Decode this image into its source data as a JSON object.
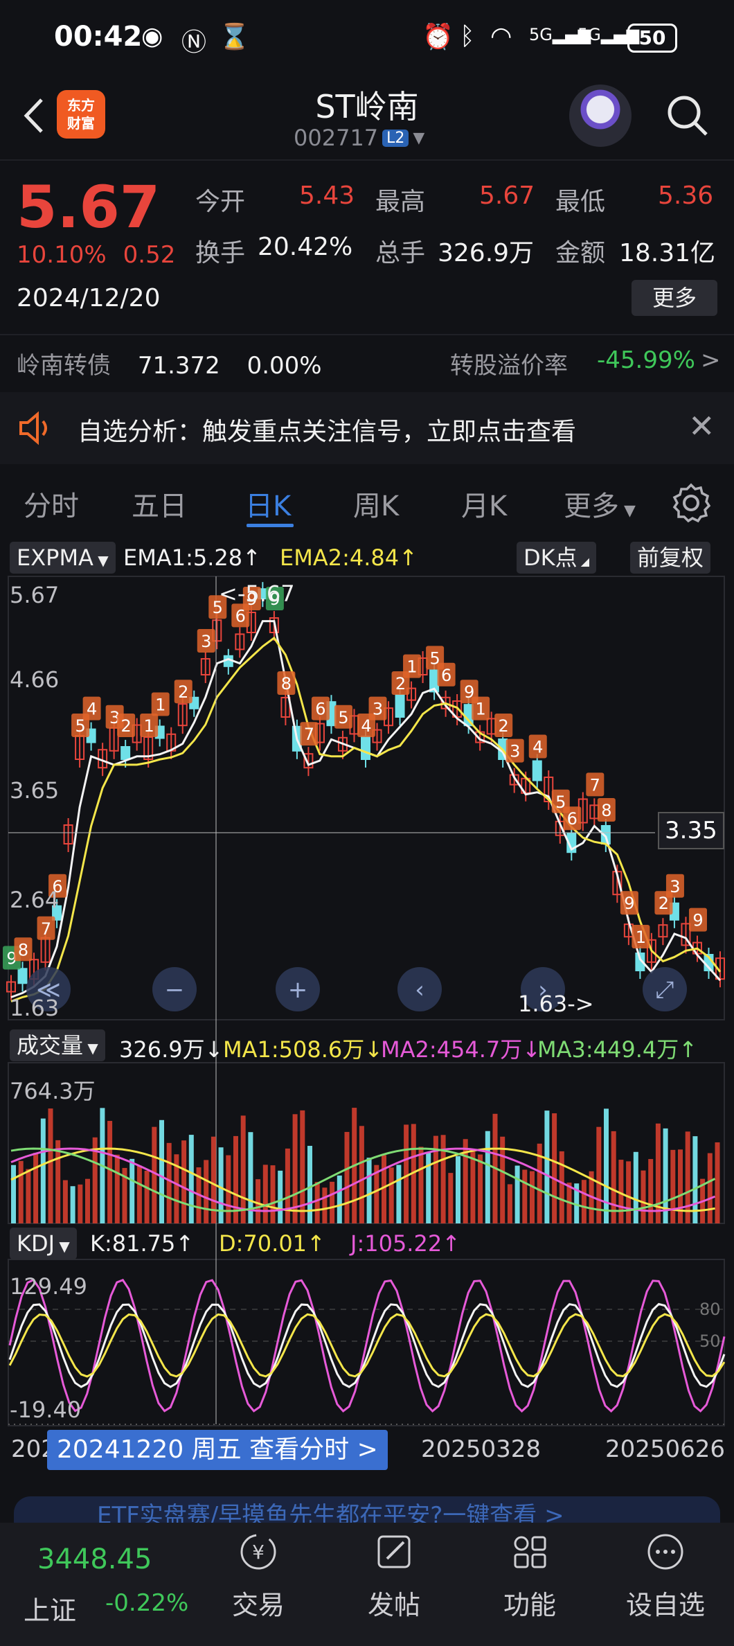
{
  "status_bar": {
    "time": "00:42",
    "battery": "50",
    "network": "5G"
  },
  "header": {
    "stock_name": "ST岭南",
    "stock_code": "002717",
    "level_badge": "L2",
    "brand_line1": "东方",
    "brand_line2": "财富"
  },
  "quote": {
    "price": "5.67",
    "change_pct": "10.10%",
    "change_amt": "0.52",
    "date": "2024/12/20",
    "open_label": "今开",
    "open": "5.43",
    "high_label": "最高",
    "high": "5.67",
    "low_label": "最低",
    "low": "5.36",
    "turnover_label": "换手",
    "turnover": "20.42%",
    "volume_label": "总手",
    "volume": "326.9万",
    "amount_label": "金额",
    "amount": "18.31亿",
    "more_label": "更多"
  },
  "convertible": {
    "name": "岭南转债",
    "price": "71.372",
    "change": "0.00%",
    "premium_label": "转股溢价率",
    "premium": "-45.99%",
    "arrow": ">"
  },
  "notice": {
    "text": "自选分析：触发重点关注信号，立即点击查看",
    "close": "✕"
  },
  "tabs": [
    {
      "label": "分时"
    },
    {
      "label": "五日"
    },
    {
      "label": "日K"
    },
    {
      "label": "周K"
    },
    {
      "label": "月K"
    },
    {
      "label": "更多"
    }
  ],
  "main_chart": {
    "indicator": "EXPMA",
    "ema1": "EMA1:5.28↑",
    "ema2": "EMA2:4.84↑",
    "dk_label": "DK点",
    "adjust_label": "前复权",
    "axis": [
      "5.67",
      "4.66",
      "3.65",
      "2.64",
      "1.63"
    ],
    "cursor_price": "3.35",
    "high_marker": "<-5.67",
    "low_marker": "1.63->",
    "td_marks": [
      "9",
      "8",
      "7",
      "6",
      "5",
      "4",
      "3",
      "2",
      "1",
      "1",
      "2",
      "3",
      "5",
      "6",
      "9",
      "9",
      "8",
      "7",
      "6",
      "5",
      "4",
      "3",
      "2",
      "1",
      "5",
      "6",
      "9",
      "1",
      "2",
      "3",
      "4",
      "5",
      "6",
      "7",
      "8",
      "9",
      "1",
      "2",
      "3",
      "9"
    ]
  },
  "volume_chart": {
    "indicator": "成交量",
    "current": "326.9万↓",
    "ma1": "MA1:508.6万↓",
    "ma2": "MA2:454.7万↓",
    "ma3": "MA3:449.4万↑",
    "axis_top": "764.3万"
  },
  "kdj_chart": {
    "indicator": "KDJ",
    "k": "K:81.75↑",
    "d": "D:70.01↑",
    "j": "J:105.22↑",
    "axis_top": "129.49",
    "axis_bottom": "-19.40",
    "level_80": "80",
    "level_50": "50"
  },
  "date_axis": {
    "start": "202",
    "mid": "20250328",
    "end": "20250626",
    "banner": "20241220 周五 查看分时 >"
  },
  "ad": {
    "text": "ETF实盘赛/早摸鱼先生都在平安?一键查看 >"
  },
  "bottom_nav": {
    "index_value": "3448.45",
    "index_name": "上证",
    "index_change": "-0.22%",
    "items": [
      {
        "label": "交易"
      },
      {
        "label": "发帖"
      },
      {
        "label": "功能"
      },
      {
        "label": "设自选"
      }
    ]
  },
  "colors": {
    "up": "#e8453c",
    "down": "#6fe0e8",
    "ema1": "#f4f4f4",
    "ema2": "#f4e64a",
    "accent": "#3b7fe0"
  }
}
